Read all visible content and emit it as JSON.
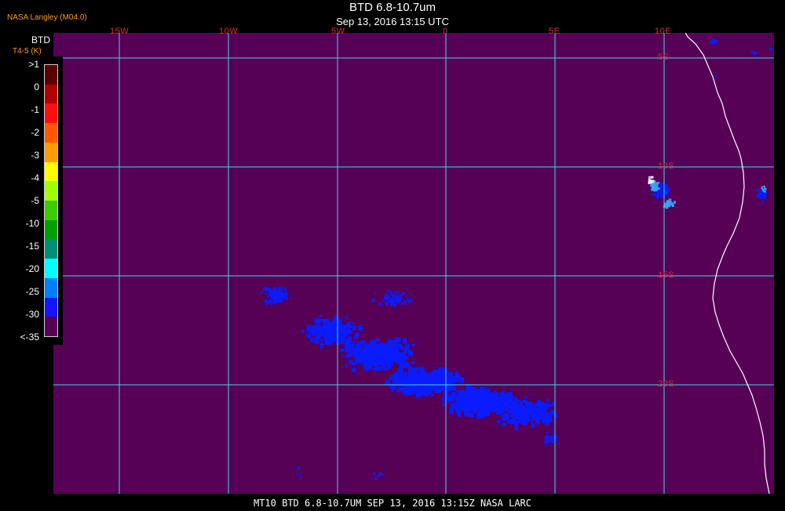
{
  "header": {
    "title": "BTD 6.8-10.7um",
    "subtitle": "Sep 13, 2016 13:15 UTC",
    "credit": "NASA Langley (M04.0)"
  },
  "legend": {
    "title": "BTD",
    "unit": "T4-5 (K)",
    "entries": [
      {
        "label": ">1",
        "color": "#5a0000"
      },
      {
        "label": "0",
        "color": "#b00000"
      },
      {
        "label": "-1",
        "color": "#ff1010"
      },
      {
        "label": "-2",
        "color": "#ff5a00"
      },
      {
        "label": "-3",
        "color": "#ff9e00"
      },
      {
        "label": "-4",
        "color": "#ffff00"
      },
      {
        "label": "-5",
        "color": "#9eff00"
      },
      {
        "label": "-10",
        "color": "#3ccc00"
      },
      {
        "label": "-15",
        "color": "#00a000"
      },
      {
        "label": "-20",
        "color": "#00907a"
      },
      {
        "label": "-25",
        "color": "#00ffff"
      },
      {
        "label": "-30",
        "color": "#0080ff"
      },
      {
        "label": "<-35",
        "color": "#1414ff"
      }
    ],
    "extra_color": "#560056"
  },
  "map": {
    "background_color": "#560056",
    "grid_color": "#3fd8f0",
    "coast_color": "#ffffff",
    "cloud_color": "#0a1cff",
    "cloud_light_color": "#3aa0ff",
    "cloud_white_color": "#dff6ff",
    "lon_labels": [
      "15W",
      "10W",
      "5W",
      "0",
      "5E",
      "10E"
    ],
    "lat_labels": [
      "5S",
      "10S",
      "15S",
      "20S"
    ]
  },
  "footer": {
    "text": "MT10   BTD 6.8-10.7UM   SEP 13, 2016 13:15Z   NASA LARC"
  }
}
